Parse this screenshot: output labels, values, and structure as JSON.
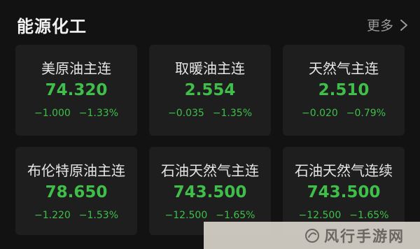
{
  "section": {
    "title": "能源化工",
    "more_label": "更多"
  },
  "colors": {
    "background": "#121212",
    "card": "#1e1e1e",
    "down_green": "#3fbf4a",
    "muted_text": "#9a9a9a"
  },
  "cards": [
    {
      "name": "美原油主连",
      "price": "74.320",
      "change": "−1.000",
      "change_pct": "−1.33%"
    },
    {
      "name": "取暖油主连",
      "price": "2.554",
      "change": "−0.035",
      "change_pct": "−1.35%"
    },
    {
      "name": "天然气主连",
      "price": "2.510",
      "change": "−0.020",
      "change_pct": "−0.79%"
    },
    {
      "name": "布伦特原油主连",
      "price": "78.650",
      "change": "−1.220",
      "change_pct": "−1.53%"
    },
    {
      "name": "石油天然气主连",
      "price": "743.500",
      "change": "−12.500",
      "change_pct": "−1.65%"
    },
    {
      "name": "石油天然气连续",
      "price": "743.500",
      "change": "−12.500",
      "change_pct": "−1.65%"
    }
  ],
  "watermark": {
    "text": "风行手游网"
  },
  "icons": {
    "more": "chevron-right-icon",
    "watermark_logo": "watermark-logo-icon"
  }
}
